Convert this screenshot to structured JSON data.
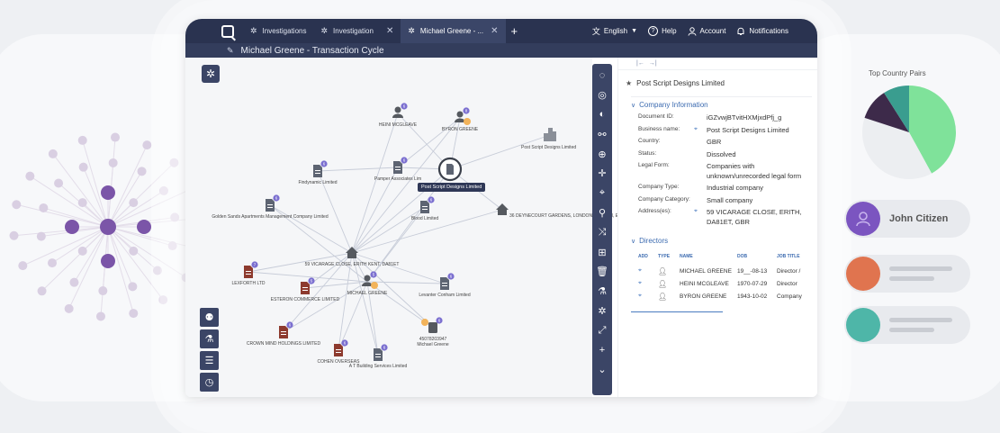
{
  "colors": {
    "titlebar": "#2a3350",
    "toolbar": "#3b4566",
    "accent": "#3c6bb0",
    "edge": "#c7ccd8",
    "badge": "#7b6fd0",
    "doc_company": "#5d6472",
    "doc_dissolved": "#8d3a2e"
  },
  "tabs": [
    {
      "label": "Investigations",
      "active": false,
      "closable": false
    },
    {
      "label": "Investigation",
      "active": false,
      "closable": true
    },
    {
      "label": "Michael Greene - ...",
      "active": true,
      "closable": true
    }
  ],
  "topbar": {
    "language": "English",
    "help": "Help",
    "account": "Account",
    "notifications": "Notifications"
  },
  "subtitle": "Michael Greene - Transaction Cycle",
  "graph": {
    "nodes": [
      {
        "id": "heini",
        "label": "HEINI MCGLEAVE",
        "kind": "person"
      },
      {
        "id": "byron",
        "label": "BYRON GREENE",
        "kind": "person"
      },
      {
        "id": "postscript",
        "label": "Post Script Designs Limited",
        "kind": "building"
      },
      {
        "id": "findynamic",
        "label": "Findynamic Limited",
        "kind": "doc"
      },
      {
        "id": "pamper",
        "label": "Pamper Associates Lim",
        "kind": "doc"
      },
      {
        "id": "postscript_sel",
        "label": "Post Script Designs Limited",
        "kind": "selected"
      },
      {
        "id": "golden",
        "label": "Golden Sands Apartments Management Company Limited",
        "kind": "doc"
      },
      {
        "id": "blood",
        "label": "Blood Limited",
        "kind": "doc"
      },
      {
        "id": "address36",
        "label": "36 DEYNECOURT GARDENS, LONDON LONDON, E11 2BT",
        "kind": "house"
      },
      {
        "id": "lexforth",
        "label": "LEXFORTH LTD",
        "kind": "doc_red"
      },
      {
        "id": "address59",
        "label": "59 VICARAGE CLOSE, ERITH KENT, DA81ET",
        "kind": "house"
      },
      {
        "id": "esteron",
        "label": "ESTERON COMMERCE LIMITED",
        "kind": "doc_red"
      },
      {
        "id": "michael",
        "label": "MICHAEL GREENE",
        "kind": "person"
      },
      {
        "id": "levanter",
        "label": "Levanter Conham Limited",
        "kind": "doc"
      },
      {
        "id": "crown",
        "label": "CROWN MIND HOLDINGS LIMITED",
        "kind": "doc_red"
      },
      {
        "id": "cohen",
        "label": "COHEN OVERSEAS",
        "kind": "doc_red"
      },
      {
        "id": "phone",
        "label": "45078203947 Michael Greene",
        "kind": "phone"
      },
      {
        "id": "atbuilding",
        "label": "A T Building Services Limited",
        "kind": "doc"
      }
    ],
    "badge_values": [
      "6",
      "8",
      "6",
      "6",
      "6",
      "6",
      "7",
      "5",
      "5",
      "6",
      "6",
      "6",
      "6",
      "6",
      "6"
    ]
  },
  "icons": {
    "graph_toggle": "hierarchy-icon",
    "left_tools": [
      "person-gear-icon",
      "flask-icon",
      "sliders-icon",
      "clock-icon"
    ],
    "vtoolbar": [
      "lasso-icon",
      "select-icon",
      "contrast-icon",
      "link-icon",
      "target-icon",
      "crosshair-icon",
      "locate-icon",
      "search-icon",
      "route-icon",
      "add-node-icon",
      "trash-icon",
      "flask-icon",
      "layout-icon",
      "expand-icon",
      "plus-icon",
      "chevron-down-icon"
    ]
  },
  "panel": {
    "title": "Post Script Designs Limited",
    "section_company": "Company Information",
    "fields": [
      {
        "key": "Document ID:",
        "value": "iGZvwjBTvitHXMjxdPfj_g",
        "has_icon": false
      },
      {
        "key": "Business name:",
        "value": "Post Script Designs Limited",
        "has_icon": true
      },
      {
        "key": "Country:",
        "value": "GBR",
        "has_icon": false
      },
      {
        "key": "Status:",
        "value": "Dissolved",
        "has_icon": false
      },
      {
        "key": "Legal Form:",
        "value": "Companies with unknown/unrecorded legal form",
        "has_icon": false
      },
      {
        "key": "Company Type:",
        "value": "Industrial company",
        "has_icon": false
      },
      {
        "key": "Company Category:",
        "value": "Small company",
        "has_icon": false
      },
      {
        "key": "Address(es):",
        "value": "59 VICARAGE CLOSE, ERITH, DA81ET, GBR",
        "has_icon": true
      }
    ],
    "section_directors": "Directors",
    "director_headers": [
      "ADD",
      "TYPE",
      "NAME",
      "DOB",
      "JOB TITLE"
    ],
    "directors": [
      {
        "name": "MICHAEL GREENE",
        "dob": "19__-08-13",
        "job": "Director /"
      },
      {
        "name": "HEINI MCGLEAVE",
        "dob": "1970-07-29",
        "job": "Director"
      },
      {
        "name": "BYRON GREENE",
        "dob": "1943-10-02",
        "job": "Company"
      }
    ]
  },
  "right_widget": {
    "title": "Top Country Pairs",
    "pie": [
      {
        "value": 42,
        "color": "#7fe29a"
      },
      {
        "value": 38,
        "color": "#eceef1"
      },
      {
        "value": 11,
        "color": "#3d2a4a"
      },
      {
        "value": 9,
        "color": "#3a9d8f"
      }
    ],
    "people": [
      {
        "name": "John Citizen",
        "color": "#7b55c0"
      },
      {
        "name": "",
        "color": "#e0744f"
      },
      {
        "name": "",
        "color": "#4eb6a8"
      }
    ]
  }
}
